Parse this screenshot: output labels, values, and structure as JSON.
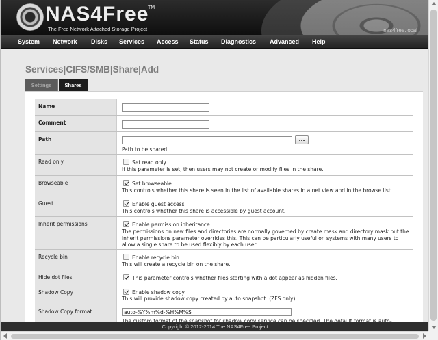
{
  "header": {
    "brand": "NAS4Free",
    "trademark": "TM",
    "tagline": "The Free Network Attached Storage Project",
    "hostname": "nas4free.local"
  },
  "nav": {
    "items": [
      "System",
      "Network",
      "Disks",
      "Services",
      "Access",
      "Status",
      "Diagnostics",
      "Advanced",
      "Help"
    ]
  },
  "page": {
    "title": "Services|CIFS/SMB|Share|Add"
  },
  "tabs": {
    "settings": "Settings",
    "shares": "Shares"
  },
  "form": {
    "name": {
      "label": "Name",
      "value": ""
    },
    "comment": {
      "label": "Comment",
      "value": ""
    },
    "path": {
      "label": "Path",
      "value": "",
      "button": "...",
      "hint": "Path to be shared."
    },
    "read_only": {
      "label": "Read only",
      "checked": false,
      "option": "Set read only",
      "desc": "If this parameter is set, then users may not create or modify files in the share."
    },
    "browseable": {
      "label": "Browseable",
      "checked": true,
      "option": "Set browseable",
      "desc": "This controls whether this share is seen in the list of available shares in a net view and in the browse list."
    },
    "guest": {
      "label": "Guest",
      "checked": true,
      "option": "Enable guest access",
      "desc": "This controls whether this share is accessible by guest account."
    },
    "inherit": {
      "label": "Inherit permissions",
      "checked": true,
      "option": "Enable permission inheritance",
      "desc": "The permissions on new files and directories are normally governed by create mask and directory mask but the inherit permissions parameter overrides this. This can be particularly useful on systems with many users to allow a single share to be used flexibly by each user."
    },
    "recycle": {
      "label": "Recycle bin",
      "checked": false,
      "option": "Enable recycle bin",
      "desc": "This will create a recycle bin on the share."
    },
    "hide_dot": {
      "label": "Hide dot files",
      "checked": true,
      "option": "This parameter controls whether files starting with a dot appear as hidden files."
    },
    "shadow": {
      "label": "Shadow Copy",
      "checked": true,
      "option": "Enable shadow copy",
      "desc": "This will provide shadow copy created by auto snapshot. (ZFS only)"
    },
    "shadow_format": {
      "label": "Shadow Copy format",
      "value": "auto-%Y%m%d-%H%M%S",
      "desc": "The custom format of the snapshot for shadow copy service can be specified. The default format is auto-"
    }
  },
  "footer": {
    "copyright": "Copyright © 2012-2014 The NAS4Free Project"
  }
}
